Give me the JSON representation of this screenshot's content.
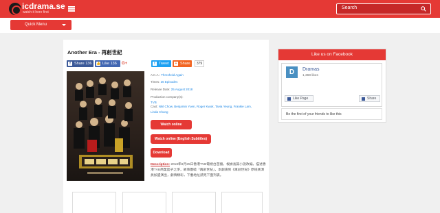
{
  "header": {
    "logo_text": "icdrama.se",
    "tagline": "watch it here first",
    "search_label": "Search"
  },
  "subnav": {
    "quick_menu_label": "Quick Menu"
  },
  "show": {
    "title": "Another Era - 再創世紀",
    "share": {
      "facebook_share": "Share 136",
      "facebook_like": "Like 136",
      "gplus": "G+",
      "tweet": "Tweet",
      "share_generic": "Share",
      "share_count": "379"
    },
    "aka_label": "A.K.A.:",
    "aka_value": "Threshold Again",
    "times_label": "Times:",
    "times_value": "36 Episodes",
    "release_label": "Release Date:",
    "release_value": "25 August 2018",
    "production_label": "Production company(s):",
    "production_value": "TVB",
    "cast_label": "Cast:",
    "cast_line1": "Nikl Chow, Benjamin Yuen, Roger Kwok, Tavia Yeung, Frankie Lam,",
    "cast_line2": "Linda Chung",
    "btn_watch_cantonese": "Watch online (Cantonese)",
    "btn_watch_english": "Watch online (English Subtitles)",
    "btn_download": "Download",
    "description_label": "Description:",
    "description_text": "2018年8月25日香港TVB電視台首播，根據長篇小說改編，描述香港TVB商業鉅子之爭，故事圍繞「再創世紀」，本劇請到《再創世紀》原班底演員加盟演出，劇情精彩，下載地址請見下面列表。"
  },
  "sidebar": {
    "fb_heading": "Like us on Facebook",
    "page_logo_letter": "D",
    "page_name": "Dramas",
    "page_likes": "1,369 likes",
    "like_page_label": "Like Page",
    "share_label": "Share",
    "footer_text": "Be the first of your friends to like this"
  },
  "colors": {
    "accent": "#e53935",
    "link": "#1e88e5",
    "facebook": "#3b5998",
    "twitter": "#1da1f2"
  }
}
